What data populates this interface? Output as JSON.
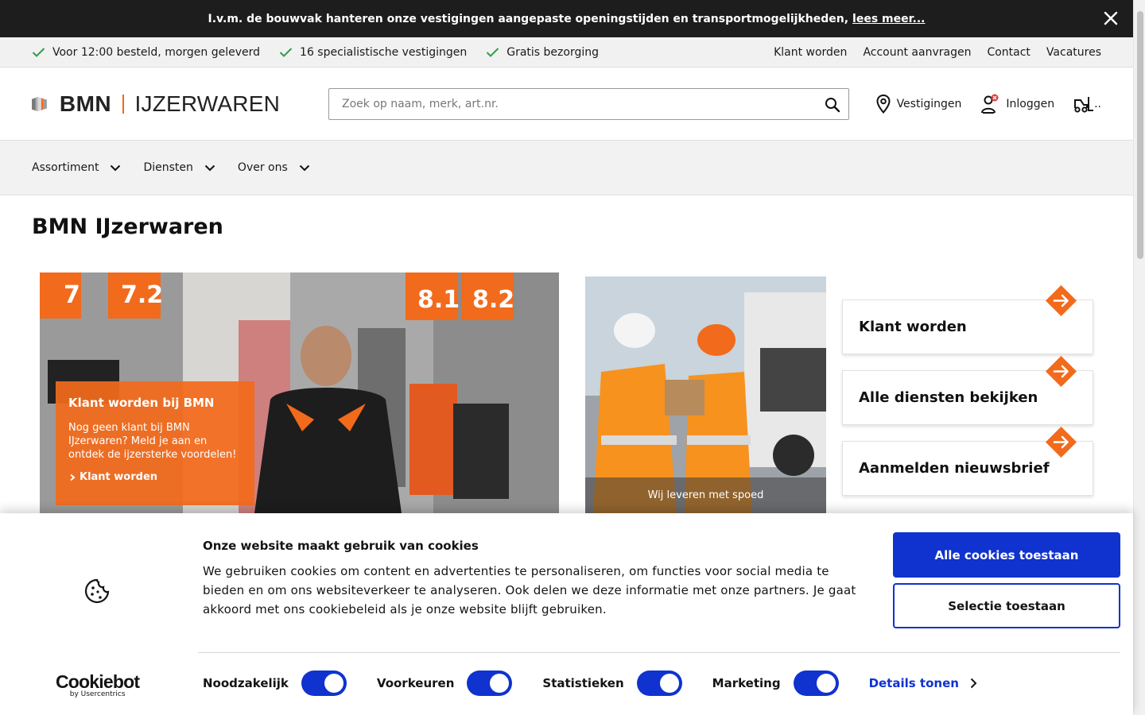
{
  "announcement": {
    "text": "I.v.m. de bouwvak hanteren onze vestigingen aangepaste openingstijden en transportmogelijkheden,",
    "link": "lees meer..."
  },
  "usp": {
    "items": [
      "Voor 12:00 besteld, morgen geleverd",
      "16 specialistische vestigingen",
      "Gratis bezorging"
    ],
    "links": [
      "Klant worden",
      "Account aanvragen",
      "Contact",
      "Vacatures"
    ]
  },
  "header": {
    "logo_bmn": "BMN",
    "logo_ij": "IJZERWAREN",
    "search_placeholder": "Zoek op naam, merk, art.nr.",
    "stores": "Vestigingen",
    "login": "Inloggen",
    "cart": ".."
  },
  "nav": [
    "Assortiment",
    "Diensten",
    "Over ons"
  ],
  "page_title": "BMN IJzerwaren",
  "hero": {
    "promo_title": "Klant worden bij BMN",
    "promo_text": "Nog geen klant bij BMN IJzerwaren? Meld je aan en ontdek de ijzersterke voordelen!",
    "promo_link": "Klant worden",
    "shelf_labels": [
      "7",
      "7.2",
      "8.1",
      "8.2"
    ]
  },
  "photo2_caption": "Wij leveren met spoed",
  "cards": [
    "Klant worden",
    "Alle diensten bekijken",
    "Aanmelden nieuwsbrief"
  ],
  "colors": {
    "accent": "#f26a1b",
    "cookie_blue": "#1032cf",
    "dark": "#1d1d1d"
  },
  "cookie": {
    "title": "Onze website maakt gebruik van cookies",
    "text": "We gebruiken cookies om content en advertenties te personaliseren, om functies voor social media te bieden en om ons websiteverkeer te analyseren. Ook delen we deze informatie met onze partners. Je gaat akkoord met ons cookiebeleid als je onze website blijft gebruiken.",
    "allow_all": "Alle cookies toestaan",
    "allow_selection": "Selectie toestaan",
    "brand": "Cookiebot",
    "brand_sub": "by Usercentrics",
    "toggles": [
      "Noodzakelijk",
      "Voorkeuren",
      "Statistieken",
      "Marketing"
    ],
    "details": "Details tonen"
  }
}
